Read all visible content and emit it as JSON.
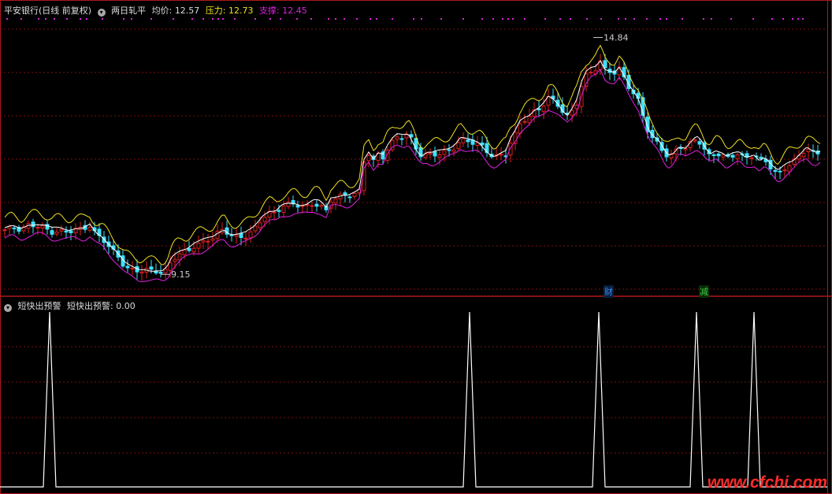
{
  "main_header": {
    "stock": "平安银行(日线 前复权)",
    "indicator": "两日轧平",
    "avg_label": "均价:",
    "avg_value": "12.57",
    "pressure_label": "压力:",
    "pressure_value": "12.73",
    "support_label": "支撑:",
    "support_value": "12.45"
  },
  "sub_header": {
    "indicator": "短快出预警",
    "label": "短快出预警:",
    "value": "0.00"
  },
  "markers": {
    "cai": "财",
    "jian": "减"
  },
  "watermark": "www.cfchi.com",
  "colors": {
    "bg": "#000000",
    "frame": "#b01818",
    "grid": "#7a1010",
    "up": "#e02020",
    "down": "#40e0ff",
    "pressure": "#f0e020",
    "avg": "#ffffff",
    "support": "#e020e0",
    "signal": "#ffffff",
    "watermark": "#ff2a2a"
  },
  "chart_data": [
    {
      "type": "candlestick",
      "title": "两日轧平",
      "ylim": [
        8.7,
        15.4
      ],
      "grid": true,
      "annotations": [
        {
          "label": "14.84",
          "value": 14.84,
          "kind": "max"
        },
        {
          "label": "9.15",
          "value": 9.15,
          "kind": "min"
        }
      ],
      "series": [
        {
          "name": "均价",
          "last": 12.57
        },
        {
          "name": "压力",
          "last": 12.73
        },
        {
          "name": "支撑",
          "last": 12.45
        }
      ],
      "close_path": [
        [
          0,
          10.22
        ],
        [
          10,
          10.25
        ],
        [
          20,
          10.18
        ],
        [
          30,
          10.3
        ],
        [
          40,
          10.32
        ],
        [
          50,
          10.28
        ],
        [
          60,
          10.2
        ],
        [
          70,
          10.22
        ],
        [
          80,
          10.18
        ],
        [
          90,
          10.22
        ],
        [
          100,
          10.2
        ],
        [
          108,
          10.28
        ],
        [
          116,
          10.08
        ],
        [
          124,
          10.0
        ],
        [
          132,
          9.85
        ],
        [
          140,
          9.7
        ],
        [
          146,
          9.55
        ],
        [
          152,
          9.38
        ],
        [
          158,
          9.3
        ],
        [
          164,
          9.25
        ],
        [
          170,
          9.22
        ],
        [
          178,
          9.24
        ],
        [
          186,
          9.2
        ],
        [
          194,
          9.18
        ],
        [
          200,
          9.16
        ],
        [
          206,
          9.25
        ],
        [
          212,
          9.5
        ],
        [
          218,
          9.62
        ],
        [
          224,
          9.7
        ],
        [
          232,
          9.75
        ],
        [
          240,
          9.85
        ],
        [
          248,
          9.9
        ],
        [
          256,
          9.95
        ],
        [
          264,
          10.0
        ],
        [
          270,
          10.1
        ],
        [
          278,
          10.2
        ],
        [
          284,
          10.1
        ],
        [
          290,
          10.05
        ],
        [
          298,
          10.05
        ],
        [
          306,
          10.1
        ],
        [
          314,
          10.22
        ],
        [
          320,
          10.35
        ],
        [
          328,
          10.55
        ],
        [
          336,
          10.62
        ],
        [
          344,
          10.6
        ],
        [
          352,
          10.75
        ],
        [
          360,
          10.8
        ],
        [
          368,
          10.82
        ],
        [
          376,
          10.78
        ],
        [
          384,
          10.8
        ],
        [
          392,
          10.88
        ],
        [
          400,
          10.85
        ],
        [
          408,
          10.7
        ],
        [
          414,
          10.95
        ],
        [
          420,
          10.98
        ],
        [
          428,
          11.02
        ],
        [
          436,
          11.0
        ],
        [
          444,
          11.05
        ],
        [
          450,
          11.12
        ],
        [
          456,
          11.85
        ],
        [
          462,
          12.05
        ],
        [
          468,
          11.9
        ],
        [
          474,
          12.05
        ],
        [
          480,
          12.0
        ],
        [
          486,
          12.2
        ],
        [
          492,
          12.35
        ],
        [
          498,
          12.45
        ],
        [
          506,
          12.45
        ],
        [
          512,
          12.5
        ],
        [
          518,
          12.3
        ],
        [
          524,
          12.05
        ],
        [
          530,
          11.95
        ],
        [
          536,
          12.02
        ],
        [
          542,
          12.0
        ],
        [
          548,
          12.05
        ],
        [
          556,
          12.1
        ],
        [
          564,
          12.15
        ],
        [
          572,
          12.25
        ],
        [
          578,
          12.4
        ],
        [
          586,
          12.35
        ],
        [
          594,
          12.3
        ],
        [
          602,
          12.25
        ],
        [
          610,
          12.1
        ],
        [
          616,
          12.0
        ],
        [
          622,
          11.95
        ],
        [
          628,
          12.0
        ],
        [
          636,
          12.05
        ],
        [
          642,
          12.35
        ],
        [
          648,
          12.55
        ],
        [
          654,
          12.8
        ],
        [
          660,
          12.9
        ],
        [
          666,
          12.95
        ],
        [
          672,
          13.05
        ],
        [
          678,
          13.1
        ],
        [
          684,
          13.2
        ],
        [
          690,
          13.35
        ],
        [
          696,
          13.3
        ],
        [
          702,
          13.2
        ],
        [
          708,
          13.05
        ],
        [
          714,
          12.95
        ],
        [
          720,
          13.1
        ],
        [
          726,
          13.3
        ],
        [
          732,
          13.7
        ],
        [
          738,
          13.95
        ],
        [
          744,
          14.05
        ],
        [
          750,
          14.1
        ],
        [
          756,
          14.25
        ],
        [
          762,
          14.05
        ],
        [
          768,
          14.0
        ],
        [
          774,
          13.95
        ],
        [
          780,
          14.05
        ],
        [
          786,
          13.85
        ],
        [
          792,
          13.65
        ],
        [
          798,
          13.5
        ],
        [
          804,
          13.35
        ],
        [
          812,
          12.9
        ],
        [
          818,
          12.55
        ],
        [
          824,
          12.4
        ],
        [
          830,
          12.3
        ],
        [
          836,
          12.1
        ],
        [
          842,
          11.95
        ],
        [
          848,
          12.0
        ],
        [
          856,
          12.2
        ],
        [
          864,
          12.15
        ],
        [
          872,
          12.3
        ],
        [
          878,
          12.4
        ],
        [
          884,
          12.3
        ],
        [
          890,
          12.1
        ],
        [
          896,
          12.0
        ],
        [
          902,
          12.1
        ],
        [
          910,
          12.05
        ],
        [
          916,
          11.95
        ],
        [
          924,
          12.0
        ],
        [
          932,
          12.02
        ],
        [
          940,
          11.9
        ],
        [
          946,
          11.95
        ],
        [
          952,
          12.0
        ],
        [
          958,
          11.85
        ],
        [
          964,
          11.92
        ],
        [
          970,
          11.8
        ],
        [
          976,
          11.65
        ],
        [
          982,
          11.58
        ],
        [
          988,
          11.7
        ],
        [
          994,
          11.8
        ],
        [
          1000,
          11.85
        ],
        [
          1006,
          11.95
        ],
        [
          1012,
          12.05
        ],
        [
          1018,
          12.15
        ],
        [
          1024,
          12.05
        ],
        [
          1030,
          12.0
        ],
        [
          1036,
          12.05
        ]
      ]
    },
    {
      "type": "line",
      "title": "短快出预警",
      "ylim": [
        0,
        1
      ],
      "grid": true,
      "last_value": 0.0,
      "signal_spikes": [
        63,
        596,
        760,
        884,
        957
      ]
    }
  ]
}
